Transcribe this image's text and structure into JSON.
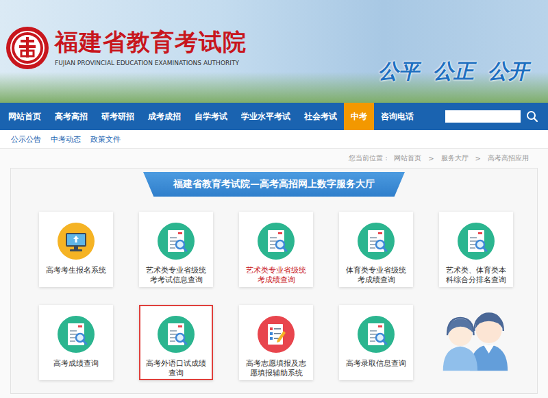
{
  "header": {
    "title": "福建省教育考试院",
    "subtitle": "FUJIAN PROVINCIAL EDUCATION EXAMINATIONS AUTHORITY",
    "slogan": [
      "公平",
      "公正",
      "公开"
    ]
  },
  "nav": [
    {
      "label": "网站首页",
      "selected": false
    },
    {
      "label": "高考高招",
      "selected": false
    },
    {
      "label": "研考研招",
      "selected": false
    },
    {
      "label": "成考成招",
      "selected": false
    },
    {
      "label": "自学考试",
      "selected": false
    },
    {
      "label": "学业水平考试",
      "selected": false
    },
    {
      "label": "社会考试",
      "selected": false
    },
    {
      "label": "中考",
      "selected": true
    },
    {
      "label": "咨询电话",
      "selected": false
    }
  ],
  "subnav": [
    "公示公告",
    "中考动态",
    "政策文件"
  ],
  "breadcrumb": {
    "prefix": "您当前位置：",
    "separator": ">",
    "items": [
      "网站首页",
      "服务大厅",
      "高考高招应用"
    ]
  },
  "panel": {
    "title": "福建省教育考试院—高考高招网上数字服务大厅",
    "tiles": [
      {
        "label": "高考考生报名系统",
        "kind": "system",
        "active": false,
        "outlined": false
      },
      {
        "label": "艺术类专业省级统考考试信息查询",
        "kind": "query",
        "active": false,
        "outlined": false
      },
      {
        "label": "艺术类专业省级统考成绩查询",
        "kind": "query",
        "active": true,
        "outlined": false
      },
      {
        "label": "体育类专业省级统考成绩查询",
        "kind": "query",
        "active": false,
        "outlined": false
      },
      {
        "label": "艺术类、体育类本科综合分排名查询",
        "kind": "query",
        "active": false,
        "outlined": false
      },
      {
        "label": "高考成绩查询",
        "kind": "query",
        "active": false,
        "outlined": false
      },
      {
        "label": "高考外语口试成绩查询",
        "kind": "query",
        "active": false,
        "outlined": true
      },
      {
        "label": "高考志愿填报及志愿填报辅助系统",
        "kind": "form",
        "active": false,
        "outlined": false
      },
      {
        "label": "高考录取信息查询",
        "kind": "query",
        "active": false,
        "outlined": false
      }
    ]
  }
}
